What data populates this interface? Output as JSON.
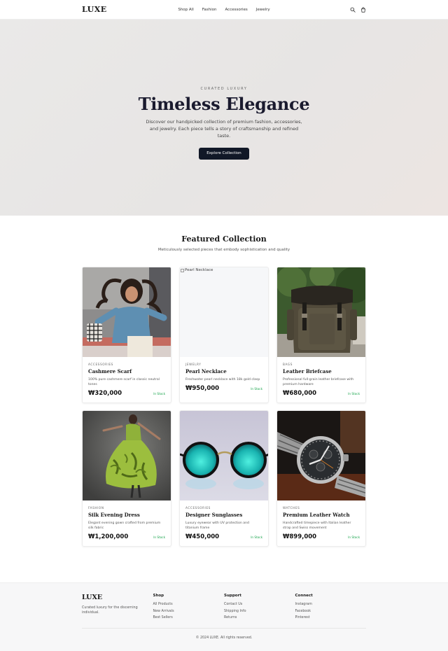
{
  "header": {
    "logo": "LUXE",
    "nav": [
      "Shop All",
      "Fashion",
      "Accessories",
      "Jewelry"
    ],
    "icons": [
      "search-icon",
      "shopping-bag-icon"
    ]
  },
  "hero": {
    "eyebrow": "CURATED LUXURY",
    "title": "Timeless Elegance",
    "description": "Discover our handpicked collection of premium fashion, accessories, and jewelry. Each piece tells a story of craftsmanship and refined taste.",
    "cta": "Explore Collection"
  },
  "featured": {
    "title": "Featured Collection",
    "subtitle": "Meticulously selected pieces that embody sophistication and quality"
  },
  "products": [
    {
      "category": "ACCESSORIES",
      "name": "Cashmere Scarf",
      "description": "100% pure cashmere scarf in classic neutral tones",
      "price": "₩320,000",
      "stock": "In Stock"
    },
    {
      "category": "JEWELRY",
      "name": "Pearl Necklace",
      "description": "Freshwater pearl necklace with 18k gold clasp",
      "price": "₩950,000",
      "stock": "In Stock",
      "image_alt": "Pearl Necklace"
    },
    {
      "category": "BAGS",
      "name": "Leather Briefcase",
      "description": "Professional full-grain leather briefcase with premium hardware",
      "price": "₩680,000",
      "stock": "In Stock"
    },
    {
      "category": "FASHION",
      "name": "Silk Evening Dress",
      "description": "Elegant evening gown crafted from premium silk fabric",
      "price": "₩1,200,000",
      "stock": "In Stock"
    },
    {
      "category": "ACCESSORIES",
      "name": "Designer Sunglasses",
      "description": "Luxury eyewear with UV protection and titanium frame",
      "price": "₩450,000",
      "stock": "In Stock"
    },
    {
      "category": "WATCHES",
      "name": "Premium Leather Watch",
      "description": "Handcrafted timepiece with Italian leather strap and Swiss movement",
      "price": "₩899,000",
      "stock": "In Stock"
    }
  ],
  "footer": {
    "logo": "LUXE",
    "tagline": "Curated luxury for the discerning individual.",
    "columns": [
      {
        "heading": "Shop",
        "links": [
          "All Products",
          "New Arrivals",
          "Best Sellers"
        ]
      },
      {
        "heading": "Support",
        "links": [
          "Contact Us",
          "Shipping Info",
          "Returns"
        ]
      },
      {
        "heading": "Connect",
        "links": [
          "Instagram",
          "Facebook",
          "Pinterest"
        ]
      }
    ],
    "copyright": "© 2024 LUXE. All rights reserved."
  },
  "colors": {
    "accent_dark": "#111827",
    "in_stock": "#16a34a",
    "hero_bg": "#e8e7e6",
    "footer_bg": "#f7f7f8"
  }
}
